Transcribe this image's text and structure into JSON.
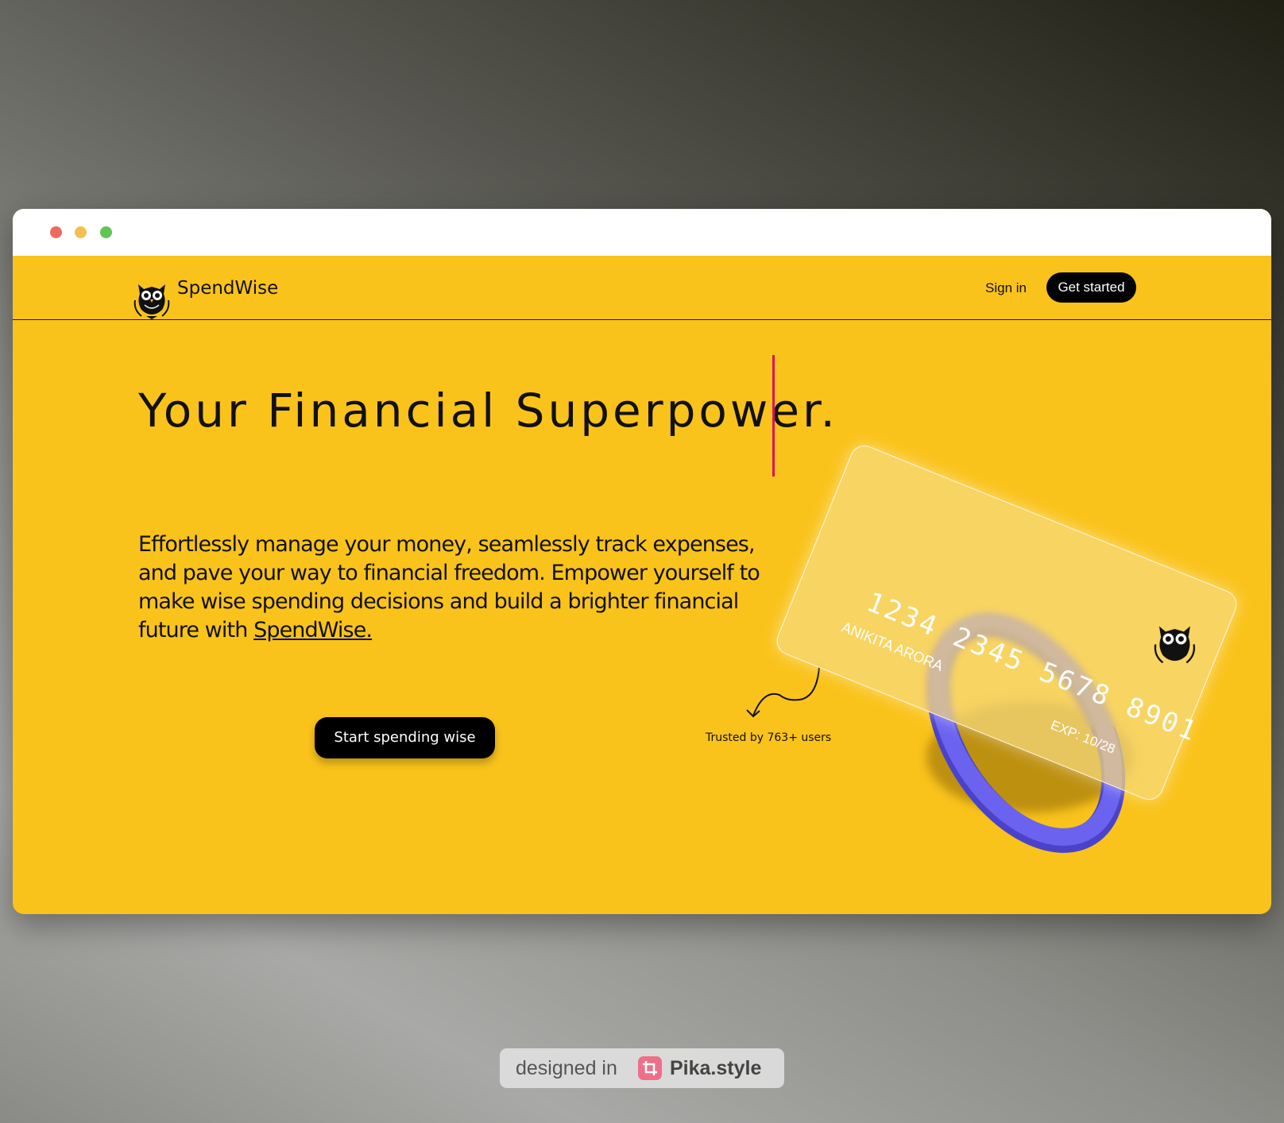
{
  "window": {
    "controls": [
      "close",
      "minimize",
      "zoom"
    ]
  },
  "nav": {
    "brand": "SpendWise",
    "logo_icon": "owl-icon",
    "sign_in": "Sign in",
    "get_started": "Get started"
  },
  "hero": {
    "title": "Your Financial Superpower.",
    "description": "Effortlessly manage your money, seamlessly track expenses, and pave your way to financial freedom. Empower yourself to make wise spending decisions and build a brighter financial future with ",
    "description_link": "SpendWise.",
    "cta": "Start spending wise",
    "trusted": "Trusted by 763+ users"
  },
  "card": {
    "number": "1234 2345 5678 8901",
    "holder": "ANIKITA ARORA",
    "expiry": "EXP: 10/28"
  },
  "colors": {
    "background": "#fac31b",
    "accent_caret": "#e0115f",
    "ring": "#6b63f0",
    "button": "#000000"
  },
  "badge": {
    "prefix": "designed in",
    "name": "Pika.style"
  }
}
